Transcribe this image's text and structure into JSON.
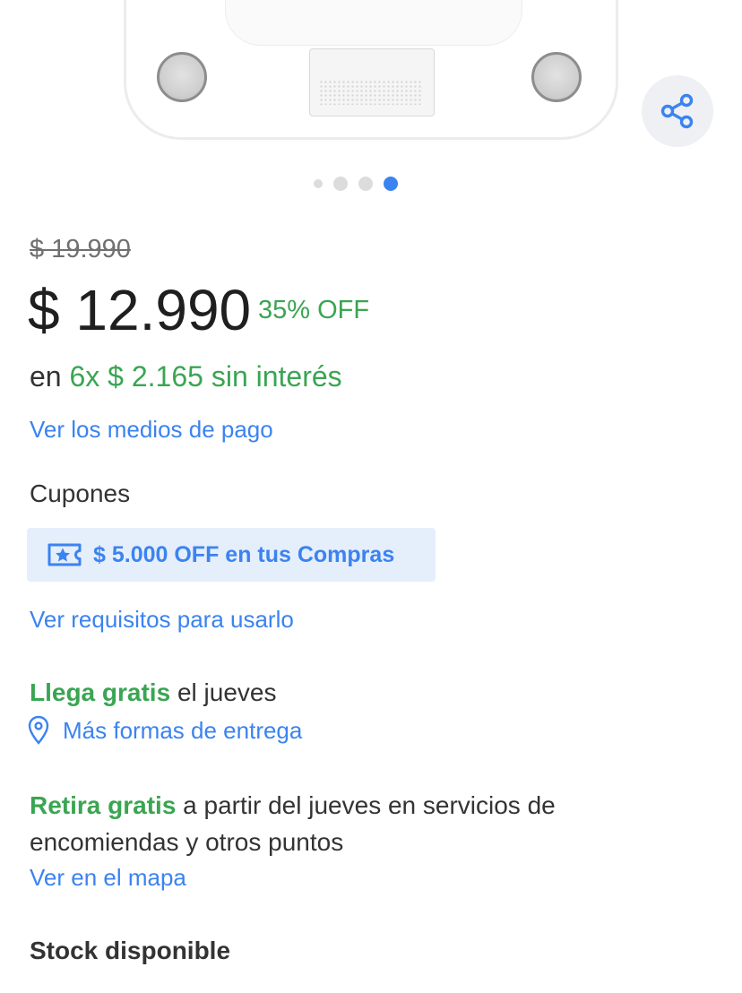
{
  "gallery": {
    "dots": [
      false,
      false,
      false,
      true
    ],
    "active_color": "#3b83f0",
    "inactive_color": "#dcdcdc"
  },
  "share": {
    "icon": "share-icon"
  },
  "price": {
    "original": "$ 19.990",
    "current": "$ 12.990",
    "discount": "35% OFF"
  },
  "installments": {
    "prefix": "en",
    "plan": "6x $ 2.165 sin interés",
    "payment_link": "Ver los medios de pago"
  },
  "coupons": {
    "title": "Cupones",
    "icon": "ticket-star-icon",
    "chip_label": "$ 5.000 OFF en tus Compras",
    "requirements_link": "Ver requisitos para usarlo"
  },
  "delivery": {
    "highlight": "Llega gratis",
    "rest": " el jueves",
    "icon": "location-pin-icon",
    "options_link": "Más formas de entrega"
  },
  "pickup": {
    "highlight": "Retira gratis",
    "rest": " a partir del jueves en servicios de encomiendas y otros puntos",
    "map_link": "Ver en el mapa"
  },
  "stock": {
    "label": "Stock disponible"
  },
  "colors": {
    "green": "#3aa552",
    "link_blue": "#3b83f0",
    "chip_bg": "#e5eefb"
  }
}
